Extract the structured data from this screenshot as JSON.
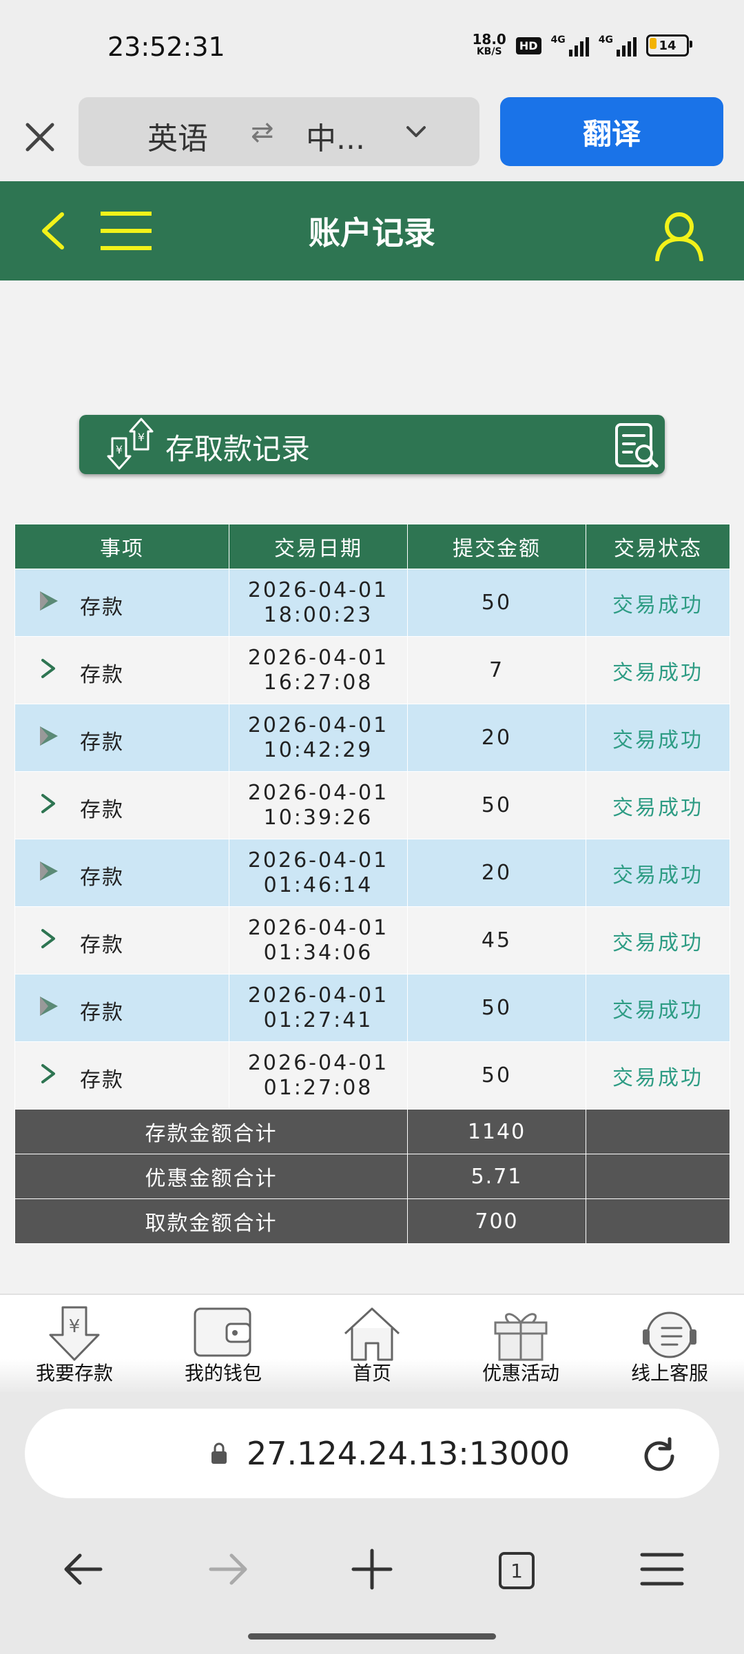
{
  "status_bar": {
    "time": "23:52:31",
    "net_speed": "18.0",
    "net_speed_unit": "KB/S",
    "hd_badge": "HD",
    "signal_1": "4G",
    "signal_2": "4G",
    "battery": "14"
  },
  "translate_bar": {
    "source_lang": "英语",
    "swap_symbol": "⇄",
    "target_lang": "中...",
    "translate_button": "翻译"
  },
  "header": {
    "title": "账户记录"
  },
  "banner": {
    "title": "存取款记录"
  },
  "table": {
    "headers": [
      "事项",
      "交易日期",
      "提交金额",
      "交易状态"
    ],
    "rows": [
      {
        "item": "存款",
        "date": "2026-04-01",
        "time": "18:00:23",
        "amount": "50",
        "status": "交易成功"
      },
      {
        "item": "存款",
        "date": "2026-04-01",
        "time": "16:27:08",
        "amount": "7",
        "status": "交易成功"
      },
      {
        "item": "存款",
        "date": "2026-04-01",
        "time": "10:42:29",
        "amount": "20",
        "status": "交易成功"
      },
      {
        "item": "存款",
        "date": "2026-04-01",
        "time": "10:39:26",
        "amount": "50",
        "status": "交易成功"
      },
      {
        "item": "存款",
        "date": "2026-04-01",
        "time": "01:46:14",
        "amount": "20",
        "status": "交易成功"
      },
      {
        "item": "存款",
        "date": "2026-04-01",
        "time": "01:34:06",
        "amount": "45",
        "status": "交易成功"
      },
      {
        "item": "存款",
        "date": "2026-04-01",
        "time": "01:27:41",
        "amount": "50",
        "status": "交易成功"
      },
      {
        "item": "存款",
        "date": "2026-04-01",
        "time": "01:27:08",
        "amount": "50",
        "status": "交易成功"
      }
    ],
    "totals": [
      {
        "label": "存款金额合计",
        "value": "1140"
      },
      {
        "label": "优惠金额合计",
        "value": "5.71"
      },
      {
        "label": "取款金额合计",
        "value": "700"
      }
    ]
  },
  "bottom_nav": {
    "items": [
      {
        "label": "我要存款",
        "icon": "deposit-icon"
      },
      {
        "label": "我的钱包",
        "icon": "wallet-icon"
      },
      {
        "label": "首页",
        "icon": "home-icon"
      },
      {
        "label": "优惠活动",
        "icon": "gift-icon"
      },
      {
        "label": "线上客服",
        "icon": "support-icon"
      }
    ]
  },
  "browser": {
    "url": "27.124.24.13:13000",
    "tab_count": "1"
  },
  "colors": {
    "brand_green": "#2e7552",
    "accent_yellow": "#f2f21a",
    "row_blue": "#cce6f5",
    "status_teal": "#2e9c84",
    "translate_blue": "#1a73e8"
  }
}
